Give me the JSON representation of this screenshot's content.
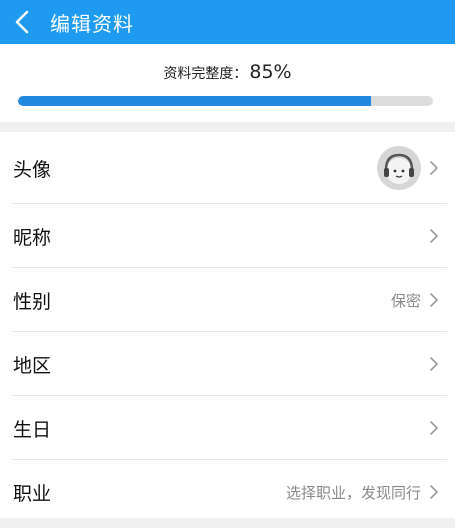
{
  "header": {
    "title": "编辑资料"
  },
  "progress": {
    "label": "资料完整度：",
    "percent_text": "85%",
    "fraction": 0.85
  },
  "rows": [
    {
      "label": "头像",
      "value": ""
    },
    {
      "label": "昵称",
      "value": ""
    },
    {
      "label": "性别",
      "value": "保密"
    },
    {
      "label": "地区",
      "value": ""
    },
    {
      "label": "生日",
      "value": ""
    },
    {
      "label": "职业",
      "value": "选择职业，发现同行"
    }
  ],
  "colors": {
    "accent": "#1e9bf0",
    "progress_fill": "#2088e0"
  }
}
